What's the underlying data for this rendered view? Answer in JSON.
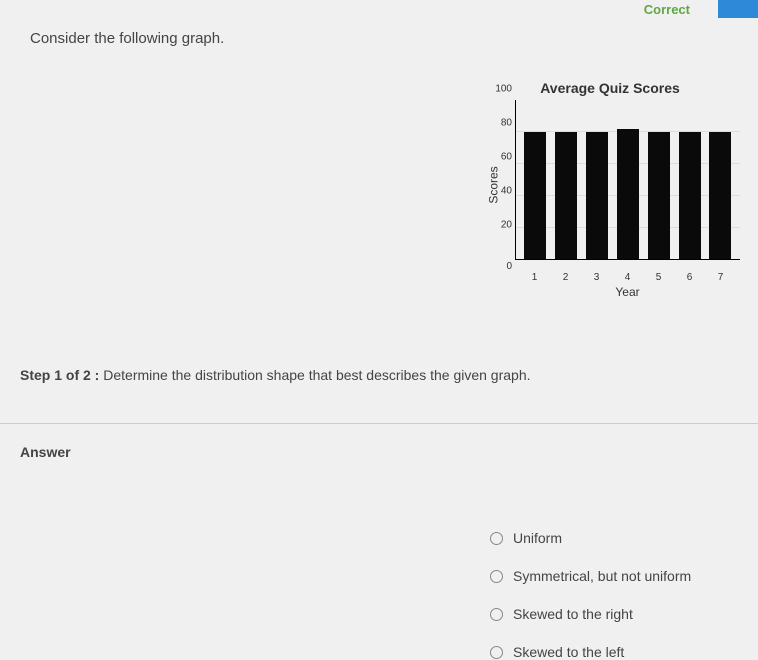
{
  "header": {
    "correct_label": "Correct"
  },
  "question": {
    "prompt": "Consider the following graph."
  },
  "chart_data": {
    "type": "bar",
    "title": "Average Quiz Scores",
    "xlabel": "Year",
    "ylabel": "Scores",
    "categories": [
      "1",
      "2",
      "3",
      "4",
      "5",
      "6",
      "7"
    ],
    "values": [
      80,
      80,
      80,
      82,
      80,
      80,
      80
    ],
    "y_ticks": [
      "0",
      "20",
      "40",
      "60",
      "80",
      "100"
    ],
    "ylim": [
      0,
      100
    ]
  },
  "step": {
    "label": "Step 1 of 2 :",
    "instruction": "Determine the distribution shape that best describes the given graph."
  },
  "answer": {
    "heading": "Answer",
    "options": [
      "Uniform",
      "Symmetrical, but not uniform",
      "Skewed to the right",
      "Skewed to the left"
    ]
  }
}
